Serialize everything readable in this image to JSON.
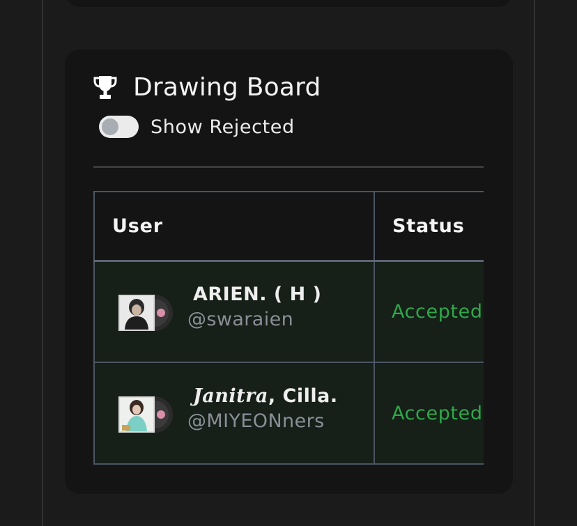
{
  "panel": {
    "title": "Drawing Board",
    "title_icon": "trophy-icon",
    "toggle": {
      "label": "Show Rejected",
      "checked": false
    }
  },
  "table": {
    "headers": {
      "user": "User",
      "status": "Status"
    },
    "rows": [
      {
        "display_name": "ARIEN. ( H )",
        "display_name_fancy": "",
        "display_name_rest": "",
        "handle": "@swaraien",
        "status": "Accepted"
      },
      {
        "display_name": "",
        "display_name_fancy": "Janitra",
        "display_name_rest": ", Cilla.",
        "handle": "@MIYEONners",
        "status": "Accepted"
      }
    ]
  },
  "colors": {
    "background": "#1b1b1b",
    "card": "#141414",
    "accepted": "#2fa84a",
    "row_bg": "#161f18",
    "border": "#4b5563"
  }
}
